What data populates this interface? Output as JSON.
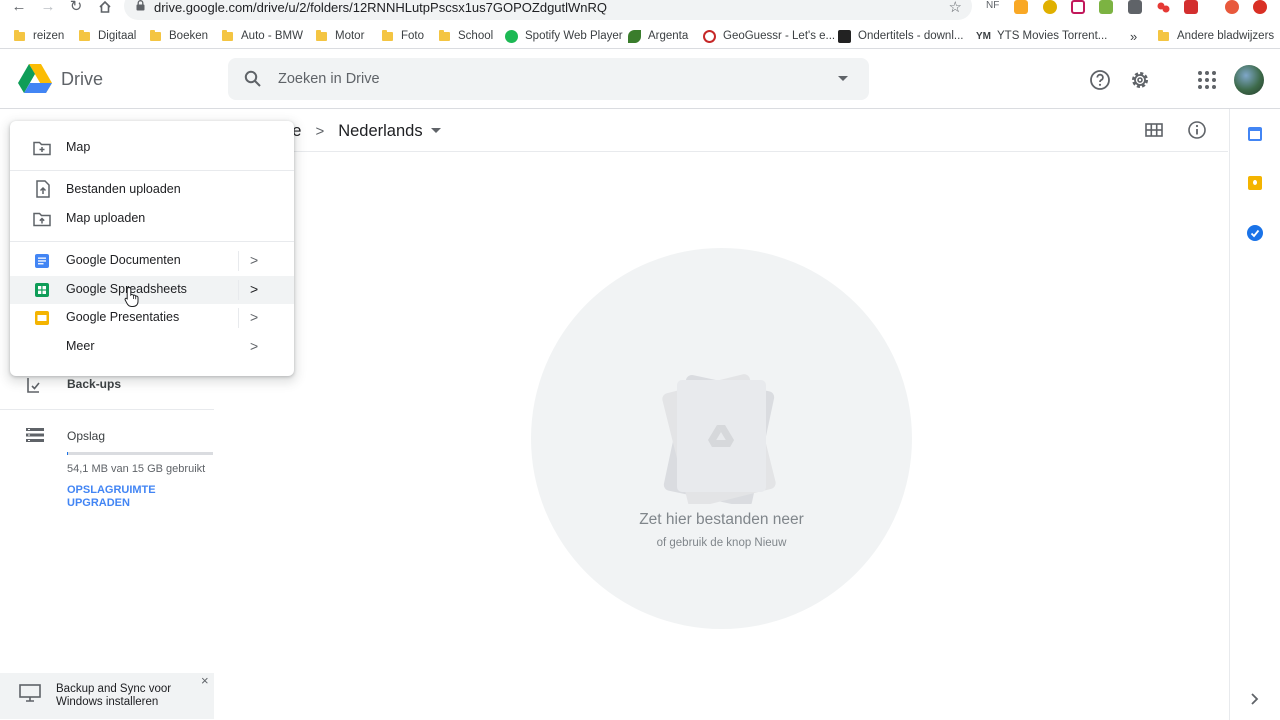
{
  "browser": {
    "url": "drive.google.com/drive/u/2/folders/12RNNHLutpPscsx1us7GOPOZdgutlWnRQ",
    "ext_nf": "NF",
    "bookmarks": [
      {
        "label": "reizen",
        "kind": "folder"
      },
      {
        "label": "Digitaal",
        "kind": "folder"
      },
      {
        "label": "Boeken",
        "kind": "folder"
      },
      {
        "label": "Auto - BMW",
        "kind": "folder"
      },
      {
        "label": "Motor",
        "kind": "folder"
      },
      {
        "label": "Foto",
        "kind": "folder"
      },
      {
        "label": "School",
        "kind": "folder"
      },
      {
        "label": "Spotify Web Player",
        "kind": "spotify"
      },
      {
        "label": "Argenta",
        "kind": "argenta"
      },
      {
        "label": "GeoGuessr - Let's e...",
        "kind": "geo"
      },
      {
        "label": "Ondertitels - downl...",
        "kind": "ondertitels"
      },
      {
        "label": "YTS Movies Torrent...",
        "kind": "yts"
      }
    ],
    "bookmarks_more": "»",
    "other_bookmarks": "Andere bladwijzers",
    "yts_prefix": "YM"
  },
  "header": {
    "app_name": "Drive",
    "search_placeholder": "Zoeken in Drive"
  },
  "breadcrumb": {
    "parent_partial": "ve",
    "separator": ">",
    "current": "Nederlands"
  },
  "menu": {
    "items": [
      {
        "label": "Map",
        "icon": "new-folder-icon"
      },
      {
        "label": "Bestanden uploaden",
        "icon": "file-upload-icon"
      },
      {
        "label": "Map uploaden",
        "icon": "folder-upload-icon"
      },
      {
        "label": "Google Documenten",
        "icon": "docs-icon",
        "submenu": true
      },
      {
        "label": "Google Spreadsheets",
        "icon": "sheets-icon",
        "submenu": true,
        "highlighted": true
      },
      {
        "label": "Google Presentaties",
        "icon": "slides-icon",
        "submenu": true
      },
      {
        "label": "Meer",
        "icon": "",
        "submenu": true
      }
    ],
    "chevron": ">"
  },
  "nav": {
    "backups": "Back-ups",
    "storage": "Opslag",
    "storage_usage": "54,1 MB van 15 GB gebruikt",
    "storage_used_fraction": 0.0036,
    "upgrade_line1": "OPSLAGRUIMTE",
    "upgrade_line2": "UPGRADEN"
  },
  "empty_state": {
    "title": "Zet hier bestanden neer",
    "subtitle": "of gebruik de knop Nieuw"
  },
  "toast": {
    "line1": "Backup and Sync voor",
    "line2": "Windows installeren",
    "close": "×"
  },
  "colors": {
    "accent_blue": "#1a73e8",
    "link_blue": "#4285f4",
    "docs_blue": "#4285f4",
    "sheets_green": "#0f9d58",
    "slides_yellow": "#f4b400",
    "folder_yellow": "#f4c542"
  }
}
